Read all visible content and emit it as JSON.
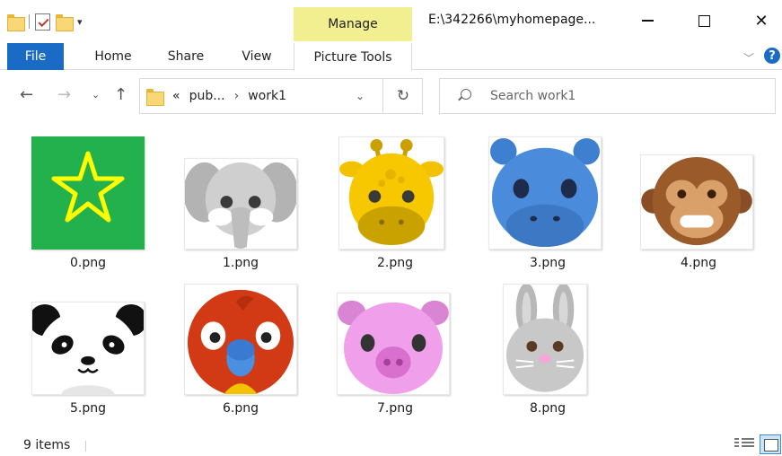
{
  "window": {
    "title": "E:\\342266\\myhomepage...",
    "context_tab": "Manage"
  },
  "ribbon": {
    "tabs": [
      {
        "label": "File"
      },
      {
        "label": "Home"
      },
      {
        "label": "Share"
      },
      {
        "label": "View"
      },
      {
        "label": "Picture Tools"
      }
    ],
    "help_label": "?"
  },
  "nav": {
    "address_parts": [
      "«",
      "pub...",
      "›",
      "work1"
    ],
    "search_placeholder": "Search work1"
  },
  "files": [
    {
      "name": "0.png",
      "icon": "star-image-icon"
    },
    {
      "name": "1.png",
      "icon": "elephant-image-icon"
    },
    {
      "name": "2.png",
      "icon": "giraffe-image-icon"
    },
    {
      "name": "3.png",
      "icon": "hippo-image-icon"
    },
    {
      "name": "4.png",
      "icon": "monkey-image-icon"
    },
    {
      "name": "5.png",
      "icon": "panda-image-icon"
    },
    {
      "name": "6.png",
      "icon": "parrot-image-icon"
    },
    {
      "name": "7.png",
      "icon": "pig-image-icon"
    },
    {
      "name": "8.png",
      "icon": "rabbit-image-icon"
    }
  ],
  "status": {
    "item_count": "9 items"
  },
  "colors": {
    "file_tab": "#1a6bc5",
    "manage_tab": "#f1ef8f",
    "selected_view": "#cde4f7"
  }
}
